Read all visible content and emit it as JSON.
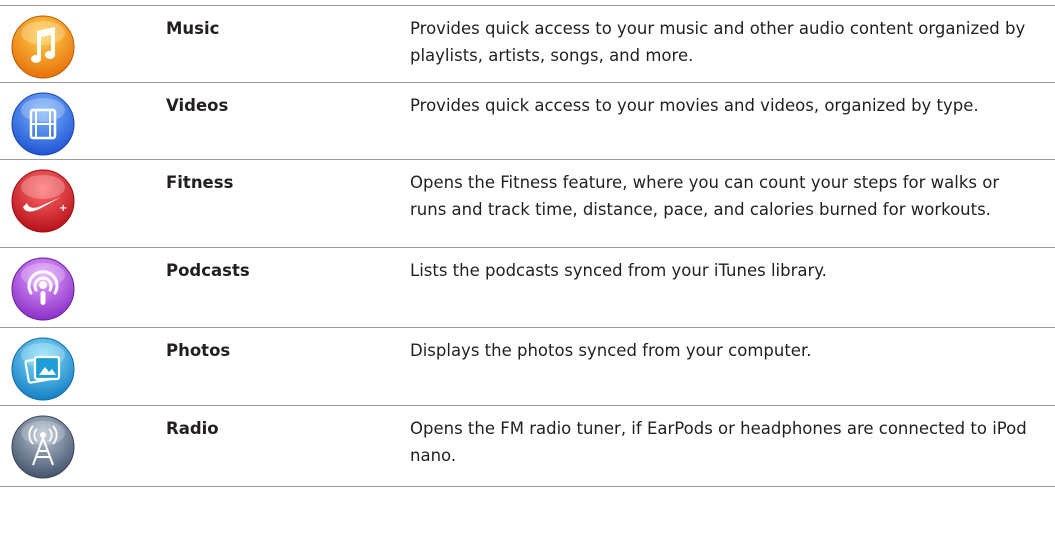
{
  "rows": [
    {
      "name": "Music",
      "description": "Provides quick access to your music and other audio content organized by playlists, artists, songs, and more.",
      "icon": "music-note-icon",
      "color": "#f08a0c"
    },
    {
      "name": "Videos",
      "description": "Provides quick access to your movies and videos, organized by type.",
      "icon": "film-strip-icon",
      "color": "#2a6ee8"
    },
    {
      "name": "Fitness",
      "description": "Opens the Fitness feature, where you can count your steps for walks or runs and track time, distance, pace, and calories burned for workouts.",
      "icon": "swoosh-plus-icon",
      "color": "#d81f26"
    },
    {
      "name": "Podcasts",
      "description": "Lists the podcasts synced from your iTunes library.",
      "icon": "podcast-icon",
      "color": "#9b3fd6"
    },
    {
      "name": "Photos",
      "description": "Displays the photos synced from your computer.",
      "icon": "photos-icon",
      "color": "#1f9ed8"
    },
    {
      "name": "Radio",
      "description": "Opens the FM radio tuner, if EarPods or headphones are connected to iPod nano.",
      "icon": "radio-tower-icon",
      "color": "#5b6c82"
    }
  ]
}
